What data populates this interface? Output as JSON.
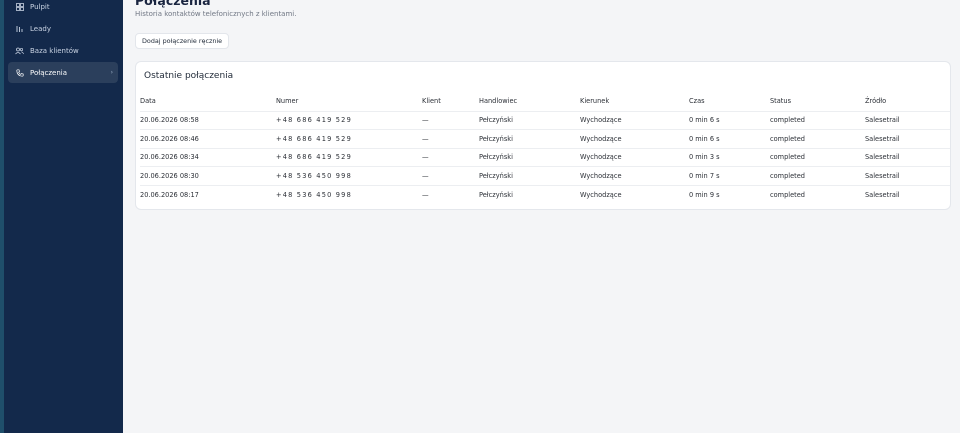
{
  "sidebar": {
    "items": [
      {
        "label": "Pulpit",
        "icon": "dashboard-icon"
      },
      {
        "label": "Leady",
        "icon": "leads-icon"
      },
      {
        "label": "Baza klientów",
        "icon": "users-icon"
      },
      {
        "label": "Połączenia",
        "icon": "phone-icon",
        "active": true
      }
    ]
  },
  "header": {
    "title": "Połączenia",
    "subtitle": "Historia kontaktów telefonicznych z klientami.",
    "add_button": "Dodaj połączenie ręcznie"
  },
  "calls": {
    "title": "Ostatnie połączenia",
    "columns": [
      "Data",
      "Numer",
      "Klient",
      "Handlowiec",
      "Kierunek",
      "Czas",
      "Status",
      "Źródło"
    ],
    "rows": [
      [
        "20.06.2026 08:58",
        "+48  686  419  529",
        "—",
        "Pełczyński",
        "Wychodzące",
        "0 min 6 s",
        "completed",
        "Salesetrail"
      ],
      [
        "20.06.2026 08:46",
        "+48  686  419  529",
        "—",
        "Pełczyński",
        "Wychodzące",
        "0 min 6 s",
        "completed",
        "Salesetrail"
      ],
      [
        "20.06.2026 08:34",
        "+48  686  419  529",
        "—",
        "Pełczyński",
        "Wychodzące",
        "0 min 3 s",
        "completed",
        "Salesetrail"
      ],
      [
        "20.06.2026 08:30",
        "+48  536  450  998",
        "—",
        "Pełczyński",
        "Wychodzące",
        "0 min 7 s",
        "completed",
        "Salesetrail"
      ],
      [
        "20.06.2026 08:17",
        "+48  536  450  998",
        "—",
        "Pełczyński",
        "Wychodzące",
        "0 min 9 s",
        "completed",
        "Salesetrail"
      ]
    ]
  },
  "colors": {
    "sidebar_bg": "#13294b",
    "active_bg": "#2b3f5c",
    "page_bg": "#f4f5f7"
  }
}
